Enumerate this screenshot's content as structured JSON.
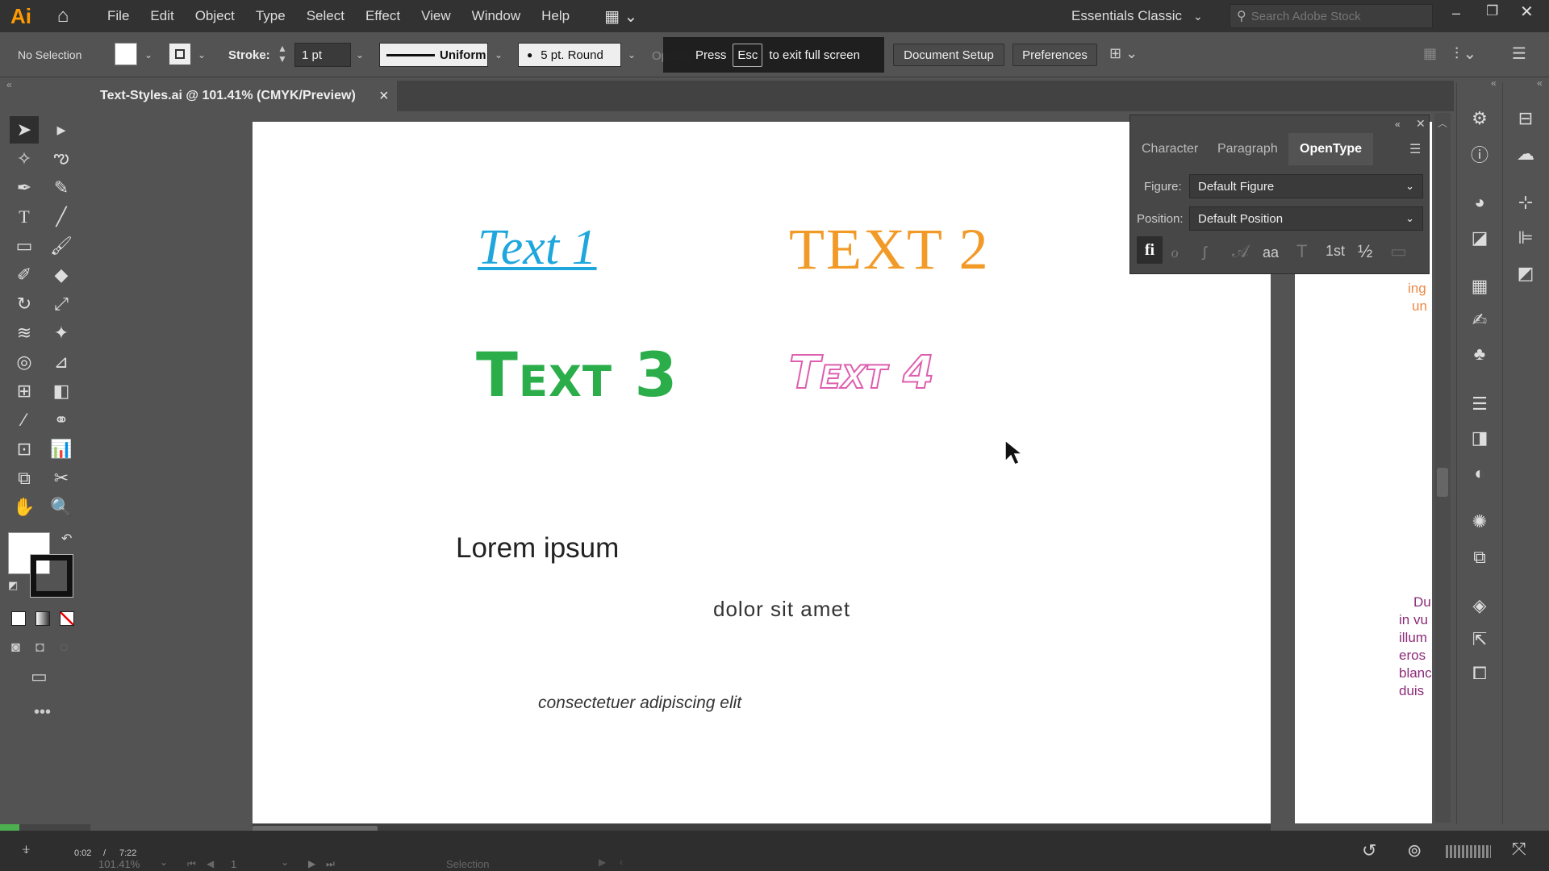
{
  "app": {
    "logo": "Ai",
    "workspace": "Essentials Classic",
    "search_placeholder": "Search Adobe Stock"
  },
  "menu": [
    "File",
    "Edit",
    "Object",
    "Type",
    "Select",
    "Effect",
    "View",
    "Window",
    "Help"
  ],
  "control": {
    "selection": "No Selection",
    "stroke_label": "Stroke:",
    "stroke_weight": "1 pt",
    "stroke_profile": "Uniform",
    "brush": "5 pt. Round",
    "opacity_label": "Opacity",
    "fullscreen_press": "Press",
    "fullscreen_key": "Esc",
    "fullscreen_msg": "to exit full screen",
    "doc_setup": "Document Setup",
    "preferences": "Preferences"
  },
  "document_tab": {
    "title": "Text-Styles.ai @ 101.41% (CMYK/Preview)",
    "close": "×"
  },
  "artboard": {
    "text1": "Text 1",
    "text2": "TEXT 2",
    "text3": "Text 3",
    "text4": "Text 4",
    "lorem": "Lorem ipsum",
    "dolor": "dolor sit amet",
    "consect": "consectetuer adipiscing elit"
  },
  "side_fragments": {
    "orange": [
      "ing",
      "un"
    ],
    "purple": [
      "Du",
      "in vu",
      "illum",
      "eros",
      "blanc",
      "duis"
    ]
  },
  "opentype_panel": {
    "tabs": [
      "Character",
      "Paragraph",
      "OpenType"
    ],
    "active_tab": "OpenType",
    "figure_label": "Figure:",
    "figure_value": "Default Figure",
    "position_label": "Position:",
    "position_value": "Default Position",
    "feature_glyphs": [
      "fi",
      "ℴ",
      "ꭍ",
      "𝒜",
      "aa",
      "T",
      "1st",
      "½",
      "▭"
    ]
  },
  "status": {
    "zoom": "101.41%",
    "artboard_num": "1",
    "tool": "Selection",
    "time_current": "0:02",
    "time_sep": "/",
    "time_total": "7:22"
  }
}
